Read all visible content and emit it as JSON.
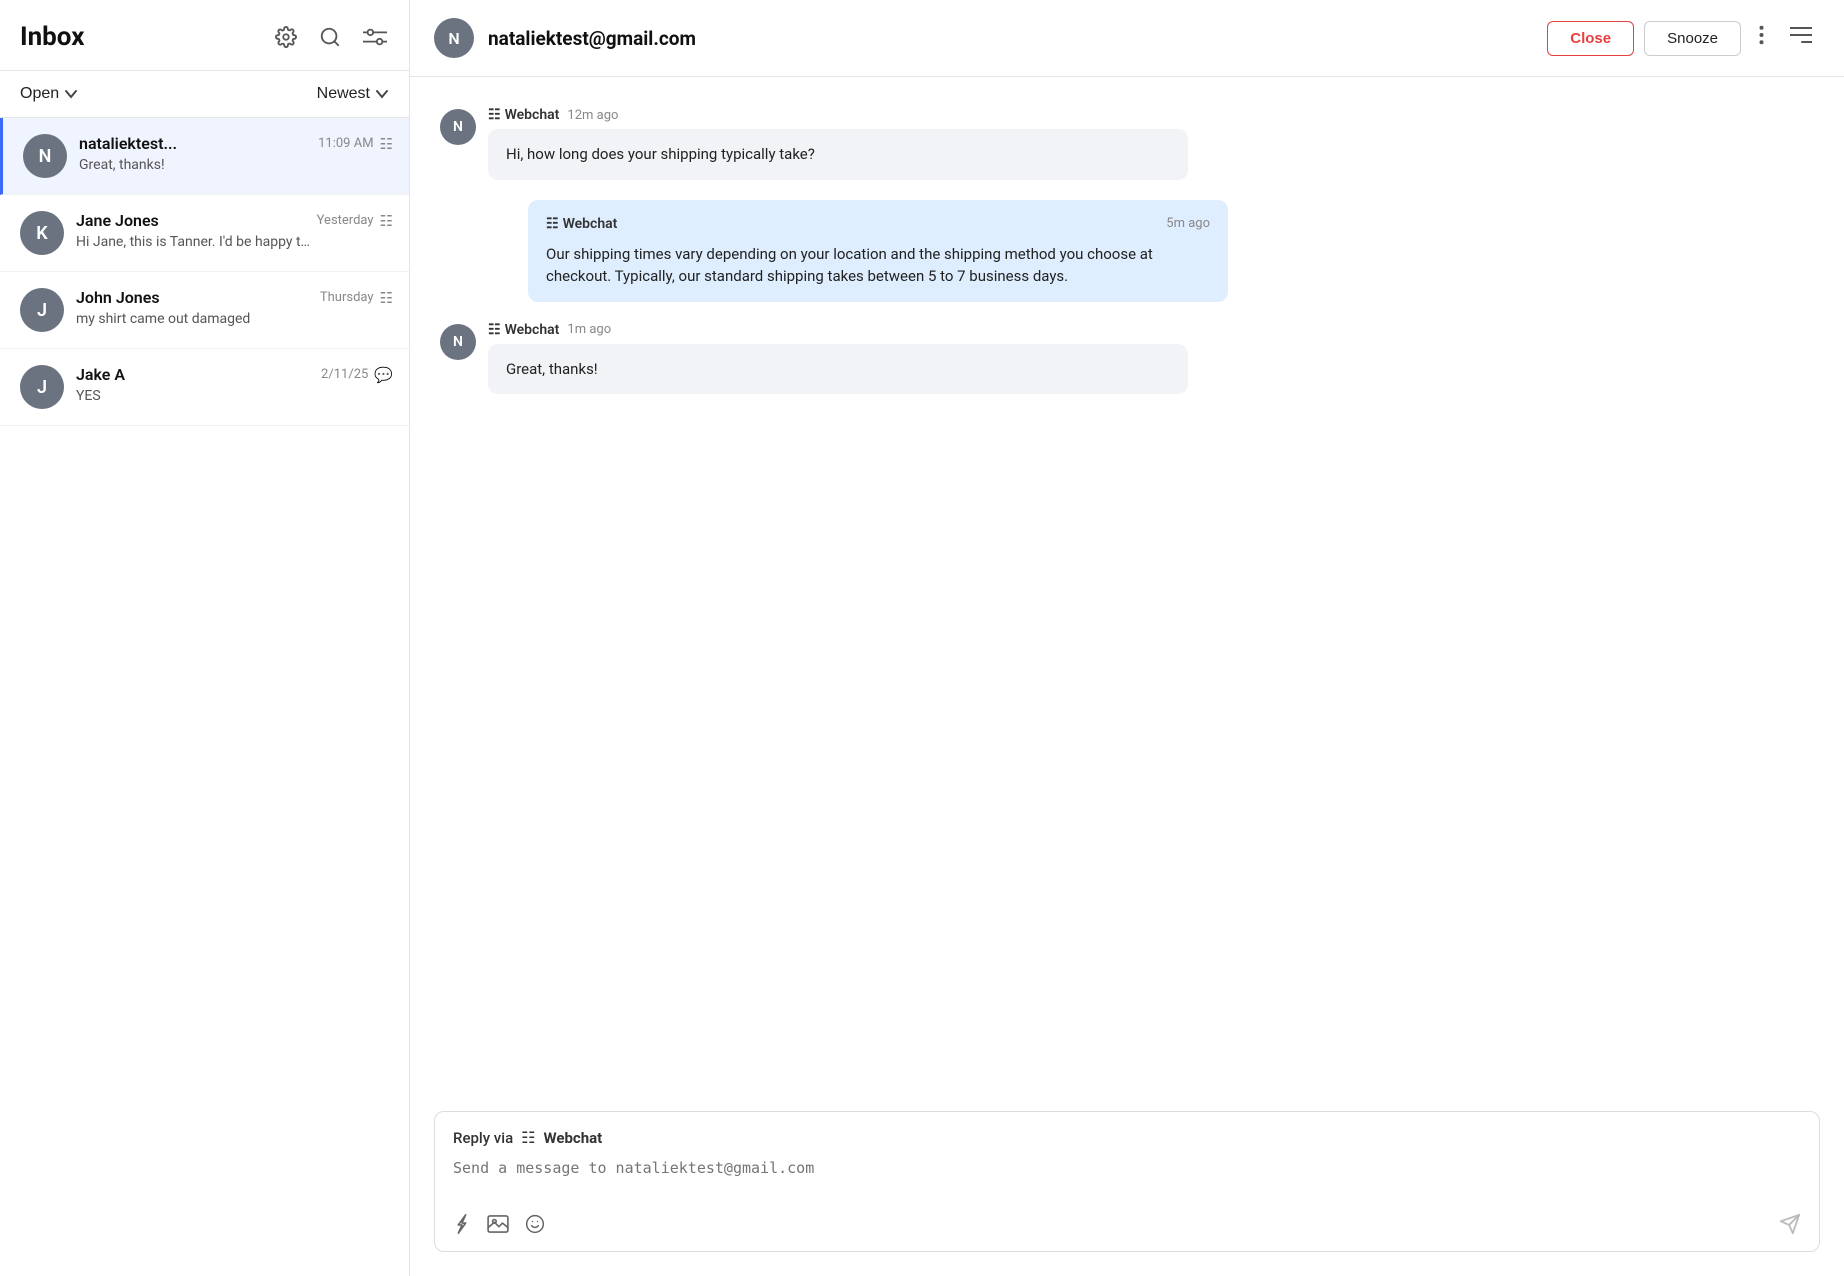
{
  "left_panel": {
    "title": "Inbox",
    "filter": {
      "status_label": "Open",
      "sort_label": "Newest"
    },
    "conversations": [
      {
        "id": "conv-1",
        "avatar_letter": "N",
        "name": "nataliektest...",
        "time": "11:09 AM",
        "preview": "Great, thanks!",
        "unread": true,
        "active": true,
        "channel": "webchat"
      },
      {
        "id": "conv-2",
        "avatar_letter": "K",
        "name": "Jane Jones",
        "time": "Yesterday",
        "preview": "Hi Jane, this is Tanner. I'd be happy to help!",
        "unread": false,
        "active": false,
        "channel": "webchat"
      },
      {
        "id": "conv-3",
        "avatar_letter": "J",
        "name": "John Jones",
        "time": "Thursday",
        "preview": "my shirt came out damaged",
        "unread": false,
        "active": false,
        "channel": "webchat"
      },
      {
        "id": "conv-4",
        "avatar_letter": "J",
        "name": "Jake A",
        "time": "2/11/25",
        "preview": "YES",
        "unread": false,
        "active": false,
        "channel": "chat"
      }
    ]
  },
  "right_panel": {
    "contact_avatar": "N",
    "contact_email": "nataliektest@gmail.com",
    "close_label": "Close",
    "snooze_label": "Snooze",
    "messages": [
      {
        "id": "msg-1",
        "avatar": "N",
        "source": "Webchat",
        "time": "12m ago",
        "text": "Hi, how long does your shipping typically take?",
        "is_response": false
      },
      {
        "id": "msg-2",
        "source": "Webchat",
        "time": "5m ago",
        "text": "Our shipping times vary depending on your location and the shipping method you choose at checkout. Typically, our standard shipping takes between 5 to 7 business days.",
        "is_response": true
      },
      {
        "id": "msg-3",
        "avatar": "N",
        "source": "Webchat",
        "time": "1m ago",
        "text": "Great, thanks!",
        "is_response": false
      }
    ],
    "reply": {
      "via_label": "Reply via",
      "channel_label": "Webchat",
      "placeholder": "Send a message to nataliektest@gmail.com"
    }
  }
}
